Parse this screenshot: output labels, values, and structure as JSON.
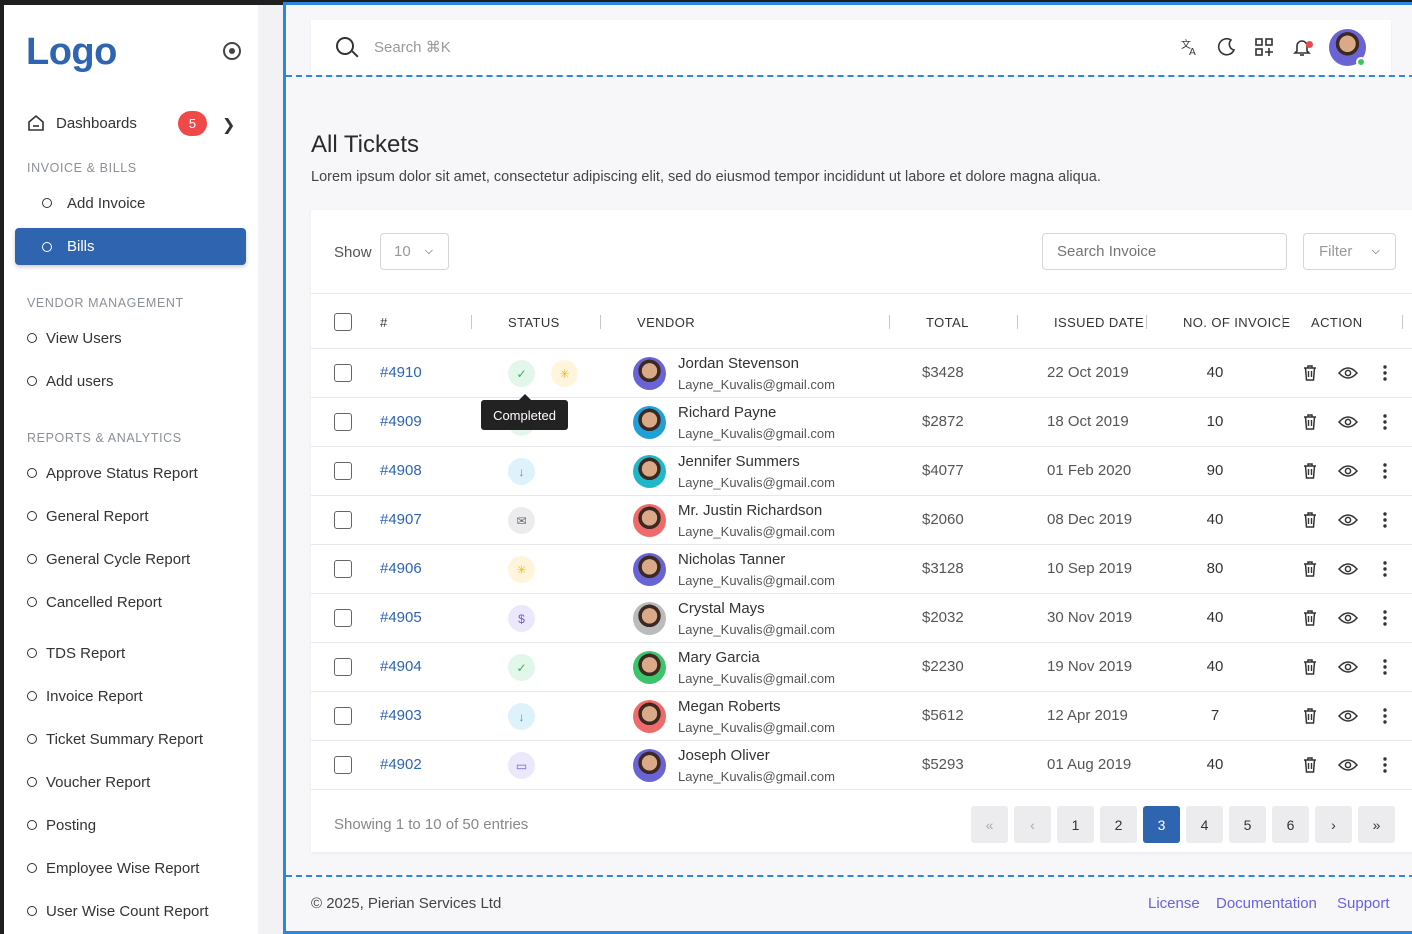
{
  "sidebar": {
    "logo": "Logo",
    "dashboards_label": "Dashboards",
    "dashboards_badge": "5",
    "sections": {
      "invoice": "INVOICE & BILLS",
      "vendor": "VENDOR MANAGEMENT",
      "reports": "REPORTS & ANALYTICS"
    },
    "invoice_items": [
      "Add Invoice",
      "Bills"
    ],
    "active_item": "Bills",
    "vendor_items": [
      "View Users",
      "Add users"
    ],
    "report_items": [
      "Approve Status Report",
      "General Report",
      "General Cycle Report",
      "Cancelled Report",
      "TDS Report",
      "Invoice Report",
      "Ticket Summary Report",
      "Voucher Report",
      "Posting",
      "Employee Wise Report",
      "User Wise Count Report"
    ]
  },
  "header": {
    "search_placeholder": "Search ⌘K",
    "icons": [
      "translate-icon",
      "dark-mode-icon",
      "apps-grid-icon",
      "bell-icon",
      "user-avatar"
    ]
  },
  "page": {
    "title": "All Tickets",
    "description": "Lorem ipsum dolor sit amet, consectetur adipiscing elit, sed do eiusmod tempor incididunt ut labore et dolore magna aliqua."
  },
  "toolbar": {
    "show_label": "Show",
    "show_value": "10",
    "search_placeholder": "Search Invoice",
    "filter_label": "Filter"
  },
  "table": {
    "columns": [
      "#",
      "STATUS",
      "VENDOR",
      "TOTAL",
      "ISSUED DATE",
      "NO. OF INVOICE",
      "ACTION"
    ],
    "rows": [
      {
        "id": "#4910",
        "status": "completed",
        "name": "Jordan Stevenson",
        "email": "Layne_Kuvalis@gmail.com",
        "total": "$3428",
        "date": "22 Oct 2019",
        "count": "40"
      },
      {
        "id": "#4909",
        "status": "completed",
        "name": "Richard Payne",
        "email": "Layne_Kuvalis@gmail.com",
        "total": "$2872",
        "date": "18 Oct 2019",
        "count": "10"
      },
      {
        "id": "#4908",
        "status": "downloaded",
        "name": "Jennifer Summers",
        "email": "Layne_Kuvalis@gmail.com",
        "total": "$4077",
        "date": "01 Feb 2020",
        "count": "90"
      },
      {
        "id": "#4907",
        "status": "sent",
        "name": "Mr. Justin Richardson",
        "email": "Layne_Kuvalis@gmail.com",
        "total": "$2060",
        "date": "08 Dec 2019",
        "count": "40"
      },
      {
        "id": "#4906",
        "status": "draft",
        "name": "Nicholas Tanner",
        "email": "Layne_Kuvalis@gmail.com",
        "total": "$3128",
        "date": "10 Sep 2019",
        "count": "80"
      },
      {
        "id": "#4905",
        "status": "paid",
        "name": "Crystal Mays",
        "email": "Layne_Kuvalis@gmail.com",
        "total": "$2032",
        "date": "30 Nov 2019",
        "count": "40"
      },
      {
        "id": "#4904",
        "status": "completed",
        "name": "Mary Garcia",
        "email": "Layne_Kuvalis@gmail.com",
        "total": "$2230",
        "date": "19 Nov 2019",
        "count": "40"
      },
      {
        "id": "#4903",
        "status": "downloaded",
        "name": "Megan Roberts",
        "email": "Layne_Kuvalis@gmail.com",
        "total": "$5612",
        "date": "12 Apr 2019",
        "count": "7"
      },
      {
        "id": "#4902",
        "status": "folder",
        "name": "Joseph Oliver",
        "email": "Layne_Kuvalis@gmail.com",
        "total": "$5293",
        "date": "01 Aug 2019",
        "count": "40"
      }
    ],
    "tooltip": "Completed"
  },
  "pagination": {
    "summary": "Showing 1 to 10 of 50 entries",
    "first": "«",
    "prev": "‹",
    "pages": [
      "1",
      "2",
      "3",
      "4",
      "5",
      "6"
    ],
    "active_page": "3",
    "next": "›",
    "last": "»"
  },
  "footer": {
    "copyright": "© 2025, Pierian Services Ltd",
    "links": [
      "License",
      "Documentation",
      "Support"
    ]
  },
  "colors": {
    "primary": "#2f64b1",
    "badge": "#ef4a4a",
    "link": "#6a63d6",
    "dashed_border": "#2f86e0"
  }
}
